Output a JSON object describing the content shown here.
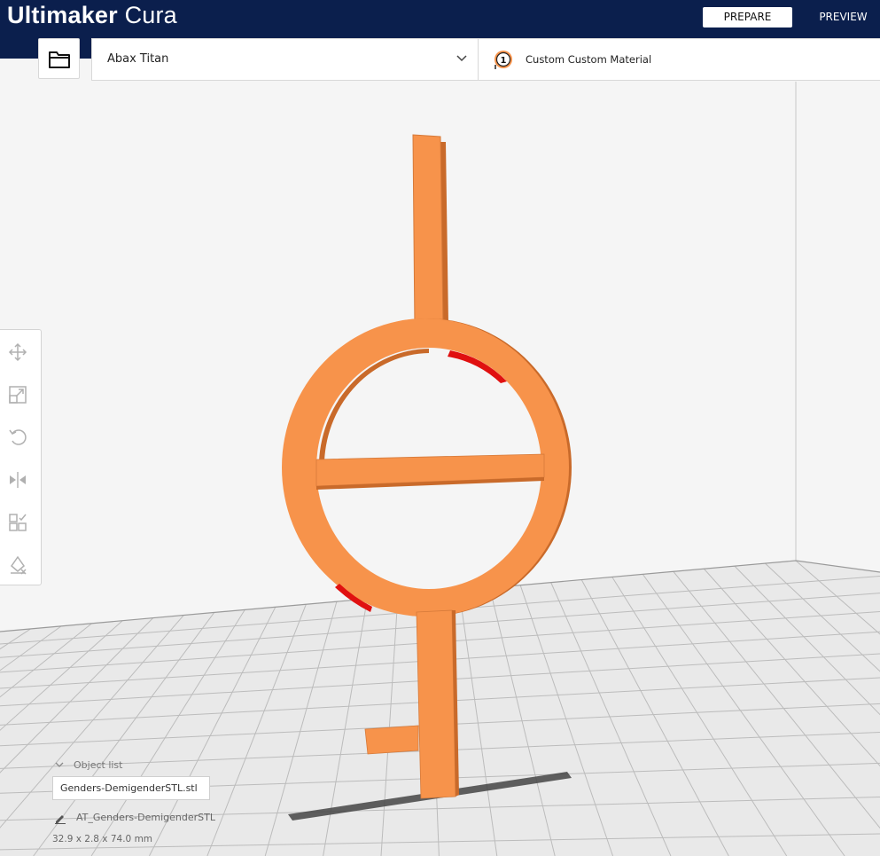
{
  "app": {
    "brand_bold": "Ultimaker",
    "brand_light": "Cura"
  },
  "stages": {
    "prepare": "PREPARE",
    "preview": "PREVIEW"
  },
  "printer": {
    "name": "Abax Titan"
  },
  "material": {
    "extruder_number": "1",
    "name": "Custom Custom Material"
  },
  "toolbar": {
    "tools": [
      "move-icon",
      "scale-icon",
      "rotate-icon",
      "mirror-icon",
      "per-model-settings-icon",
      "support-blocker-icon"
    ]
  },
  "object_list": {
    "toggle_label": "Object list",
    "file_name": "Genders-DemigenderSTL.stl",
    "object_name": "AT_Genders-DemigenderSTL",
    "dimensions": "32.9 x 2.8 x 74.0 mm"
  },
  "colors": {
    "header": "#0b1f4d",
    "model": "#f7934b",
    "model_shade": "#d06f2e",
    "overhang": "#e01010",
    "grid_line": "#bdbdbd"
  }
}
